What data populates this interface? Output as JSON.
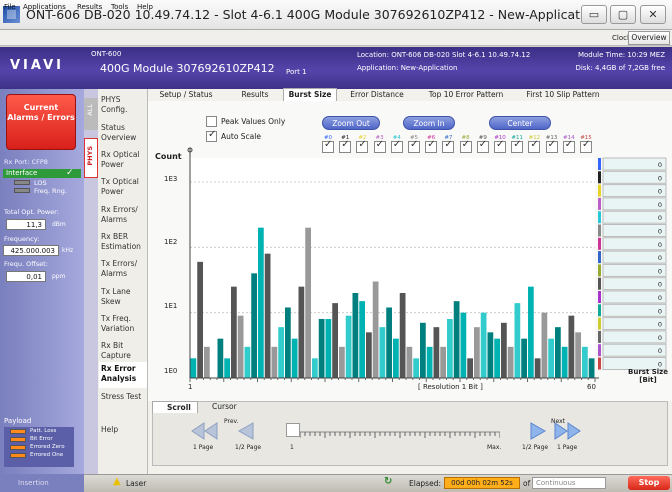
{
  "window": {
    "title": "ONT-606  DB-020 10.49.74.12 - Slot 4-6.1 400G Module 307692610ZP412 - New-Application",
    "minimize": "▭",
    "maximize": "▢",
    "close": "✕"
  },
  "menu": {
    "items": [
      "File",
      "Applications",
      "Results",
      "Tools",
      "Help"
    ],
    "clock": "Clock",
    "overview": "Overview"
  },
  "header": {
    "logo": "VIAVI",
    "model": "ONT-600",
    "module": "400G Module 307692610ZP412",
    "port": "Port 1",
    "location": "Location: ONT-606 DB-020 Slot 4-6.1  10.49.74.12",
    "application": "Application: New-Application",
    "module_time": "Module Time: 10:29 MEZ",
    "disk": "Disk: 4,4GB of 7,2GB free"
  },
  "left_panel": {
    "alarm_button": "Current Alarms / Errors",
    "rx_port": "Rx Port: CFP8",
    "interface": "Interface",
    "flags": [
      "LOS",
      "Freq. Rng."
    ],
    "total_power_label": "Total Opt. Power:",
    "total_power_value": "11,3",
    "total_power_unit": "dBm",
    "freq_label": "Frequency:",
    "freq_value": "425.000.003",
    "freq_unit": "kHz",
    "offset_label": "Frequ. Offset:",
    "offset_value": "0,01",
    "offset_unit": "ppm",
    "payload": "Payload",
    "payload_flags": [
      "Patt. Loss",
      "Bit Error",
      "Errored Zero",
      "Errored One"
    ],
    "insertion": "Insertion"
  },
  "side_tabs": [
    "ALL",
    "PHYS"
  ],
  "nav": [
    "PHYS Config.",
    "Status Overview",
    "Rx Optical Power",
    "Tx Optical Power",
    "Rx Errors/ Alarms",
    "Rx BER Estimation",
    "Tx Errors/ Alarms",
    "Tx Lane Skew",
    "Tx Freq. Variation",
    "Rx Bit Capture",
    "Rx Error Analysis",
    "Stress Test",
    "Help"
  ],
  "content_tabs": [
    "Setup / Status",
    "Results",
    "Burst Size",
    "Error Distance",
    "Top 10 Error Pattern",
    "First 10 Slip Pattern"
  ],
  "controls": {
    "peak_values": "Peak Values Only",
    "auto_scale": "Auto Scale",
    "zoom_out": "Zoom Out",
    "zoom_in": "Zoom In",
    "center": "Center"
  },
  "series_numbers": [
    "#0",
    "#1",
    "#2",
    "#3",
    "#4",
    "#5",
    "#6",
    "#7",
    "#8",
    "#9",
    "#10",
    "#11",
    "#12",
    "#13",
    "#14",
    "#15"
  ],
  "series_colors": [
    "#3366ff",
    "#222222",
    "#e6d22a",
    "#b860c8",
    "#28c8d8",
    "#888888",
    "#cc3399",
    "#3366cc",
    "#99aa33",
    "#555555",
    "#aa33cc",
    "#11aa99",
    "#cccc33",
    "#666666",
    "#aa55cc",
    "#cc4444"
  ],
  "legend_values": [
    "0",
    "0",
    "0",
    "0",
    "0",
    "0",
    "0",
    "0",
    "0",
    "0",
    "0",
    "0",
    "0",
    "0",
    "0",
    "0"
  ],
  "chart_data": {
    "type": "bar",
    "ylabel": "Count",
    "xlabel": "Burst Size [Bit]",
    "resolution_label": "[ Resolution 1 Bit ]",
    "x_tick_labels": [
      "1",
      "60"
    ],
    "y_scale": "log",
    "y_tick_labels": [
      "1E0",
      "1E1",
      "1E2",
      "1E3"
    ],
    "ylim": [
      1,
      1000
    ],
    "xlim": [
      1,
      60
    ],
    "bar_colors": [
      "#00b3b3",
      "#555555",
      "#999999",
      "#33cccc",
      "#007f7f"
    ],
    "values": [
      2,
      60,
      3,
      1,
      4,
      2,
      25,
      9,
      3,
      40,
      200,
      80,
      3,
      6,
      12,
      4,
      25,
      200,
      2,
      8,
      8,
      14,
      3,
      9,
      20,
      15,
      5,
      30,
      6,
      12,
      4,
      20,
      3,
      2,
      7,
      3,
      6,
      3,
      8,
      15,
      10,
      2,
      6,
      10,
      5,
      4,
      7,
      3,
      14,
      4,
      25,
      2,
      10,
      4,
      6,
      3,
      9,
      5,
      3,
      2
    ]
  },
  "scroll": {
    "tabs": [
      "Scroll",
      "Cursor"
    ],
    "prev": "Prev.",
    "next": "Next",
    "one_page": "1 Page",
    "half_page": "1/2 Page",
    "min": "1",
    "max": "Max."
  },
  "status": {
    "laser": "Laser",
    "elapsed_label": "Elapsed:",
    "elapsed_value": "00d 00h 02m 52s",
    "of": "of",
    "continuous": "Continuous",
    "stop": "Stop"
  }
}
